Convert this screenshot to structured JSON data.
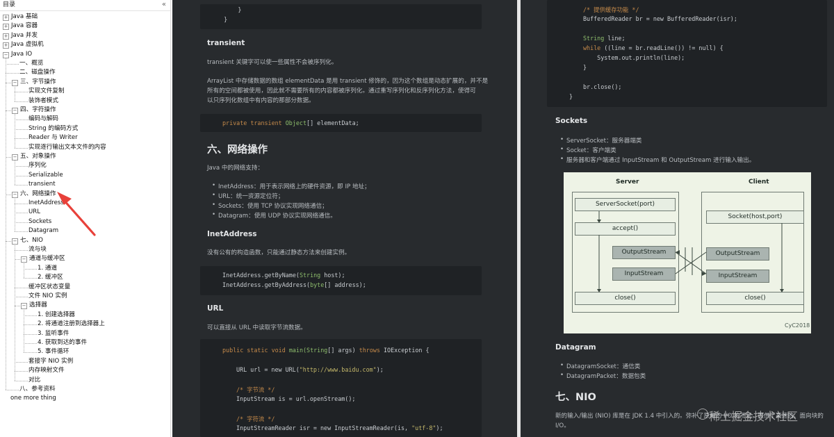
{
  "sidebar": {
    "title": "目录",
    "close": "«",
    "toc": [
      {
        "label": "Java 基础",
        "level": 0,
        "toggle": "+"
      },
      {
        "label": "Java 容器",
        "level": 0,
        "toggle": "+"
      },
      {
        "label": "Java 并发",
        "level": 0,
        "toggle": "+"
      },
      {
        "label": "Java 虚拟机",
        "level": 0,
        "toggle": "+"
      },
      {
        "label": "Java IO",
        "level": 0,
        "toggle": "−"
      },
      {
        "label": "一、概览",
        "level": 1
      },
      {
        "label": "二、磁盘操作",
        "level": 1
      },
      {
        "label": "三、字节操作",
        "level": 1,
        "toggle": "−"
      },
      {
        "label": "实现文件复制",
        "level": 2
      },
      {
        "label": "装饰者模式",
        "level": 2
      },
      {
        "label": "四、字符操作",
        "level": 1,
        "toggle": "−"
      },
      {
        "label": "编码与解码",
        "level": 2
      },
      {
        "label": "String 的编码方式",
        "level": 2
      },
      {
        "label": "Reader 与 Writer",
        "level": 2
      },
      {
        "label": "实现逐行输出文本文件的内容",
        "level": 2
      },
      {
        "label": "五、对象操作",
        "level": 1,
        "toggle": "−"
      },
      {
        "label": "序列化",
        "level": 2
      },
      {
        "label": "Serializable",
        "level": 2
      },
      {
        "label": "transient",
        "level": 2
      },
      {
        "label": "六、网络操作",
        "level": 1,
        "toggle": "−",
        "highlight": true
      },
      {
        "label": "InetAddress",
        "level": 2
      },
      {
        "label": "URL",
        "level": 2
      },
      {
        "label": "Sockets",
        "level": 2
      },
      {
        "label": "Datagram",
        "level": 2
      },
      {
        "label": "七、NIO",
        "level": 1,
        "toggle": "−"
      },
      {
        "label": "流与块",
        "level": 2
      },
      {
        "label": "通道与缓冲区",
        "level": 2,
        "toggle": "−"
      },
      {
        "label": "1. 通道",
        "level": 3
      },
      {
        "label": "2. 缓冲区",
        "level": 3
      },
      {
        "label": "缓冲区状态变量",
        "level": 2
      },
      {
        "label": "文件 NIO 实例",
        "level": 2
      },
      {
        "label": "选择器",
        "level": 2,
        "toggle": "−"
      },
      {
        "label": "1. 创建选择器",
        "level": 3
      },
      {
        "label": "2. 将通道注册到选择器上",
        "level": 3
      },
      {
        "label": "3. 监听事件",
        "level": 3
      },
      {
        "label": "4. 获取到达的事件",
        "level": 3
      },
      {
        "label": "5. 事件循环",
        "level": 3
      },
      {
        "label": "套接字 NIO 实例",
        "level": 2
      },
      {
        "label": "内存映射文件",
        "level": 2
      },
      {
        "label": "对比",
        "level": 2
      },
      {
        "label": "八、参考资料",
        "level": 1
      },
      {
        "label": "one more thing",
        "level": 0
      }
    ]
  },
  "left": {
    "code_top": [
      "        }",
      "    }"
    ],
    "h_transient": "transient",
    "p_transient": "transient 关键字可以使一些属性不会被序列化。",
    "p_arraylist": [
      "ArrayList 中存储数据的数组 elementData 是用 transient 修饰的，因为这个数组是动态扩展的，并不是",
      "所有的空间都被使用，因此就不需要所有的内容都被序列化。通过重写序列化和反序列化方法，使得可",
      "以只序列化数组中有内容的那部分数据。"
    ],
    "code_transient": {
      "kw": "private transient ",
      "ty": "Object",
      "rest": "[] elementData;"
    },
    "h_network": "六、网络操作",
    "p_network": "Java 中的网络支持：",
    "net_list": [
      "InetAddress：用于表示网络上的硬件资源，即 IP 地址；",
      "URL：统一资源定位符；",
      "Sockets：使用 TCP 协议实现网络通信；",
      "Datagram：使用 UDP 协议实现网络通信。"
    ],
    "h_inet": "InetAddress",
    "p_inet": "没有公有的构造函数，只能通过静态方法来创建实例。",
    "code_inet": [
      {
        "a": "InetAddress.getByName(",
        "t": "String",
        "b": " host);"
      },
      {
        "a": "InetAddress.getByAddress(",
        "t": "byte",
        "b": "[] address);"
      }
    ],
    "h_url": "URL",
    "p_url": "可以直接从 URL 中读取字节流数据。",
    "code_url": {
      "l1": {
        "kw": "public static void ",
        "fn": "main(",
        "ty": "String",
        "mid": "[] args) ",
        "kw2": "throws",
        "end": " IOException {"
      },
      "l2": {
        "a": "URL url = new URL(",
        "s": "\"http://www.baidu.com\"",
        "b": ");"
      },
      "c1": "/* 字节流 */",
      "l3": "InputStream is = url.openStream();",
      "c2": "/* 字符流 */",
      "l4": {
        "a": "InputStreamReader isr = new InputStreamReader(is, ",
        "s": "\"utf-8\"",
        "b": ");"
      }
    }
  },
  "right": {
    "code_top": [
      {
        "c": "/* 提供缓存功能 */"
      },
      {
        "t": "BufferedReader br = new BufferedReader(isr);"
      },
      {
        "t": ""
      },
      {
        "ty": "String",
        "t": " line;"
      },
      {
        "kw": "while",
        "t": " ((line = br.readLine()) != null) {"
      },
      {
        "t": "    System.out.println(line);"
      },
      {
        "t": "}"
      },
      {
        "t": ""
      },
      {
        "t": "br.close();"
      }
    ],
    "code_close": "}",
    "h_sockets": "Sockets",
    "sockets_list": [
      "ServerSocket：服务器端类",
      "Socket：客户端类",
      "服务器和客户端通过 InputStream 和 OutputStream 进行输入输出。"
    ],
    "diagram": {
      "server_title": "Server",
      "client_title": "Client",
      "server_socket": "ServerSocket(port)",
      "accept": "accept()",
      "output_stream_s": "OutputStream",
      "input_stream_s": "InputStream",
      "close_s": "close()",
      "socket": "Socket(host,port)",
      "output_stream_c": "OutputStream",
      "input_stream_c": "InputStream",
      "close_c": "close()",
      "credit": "CyC2018"
    },
    "h_datagram": "Datagram",
    "datagram_list": [
      "DatagramSocket：通信类",
      "DatagramPacket：数据包类"
    ],
    "h_nio": "七、NIO",
    "p_nio": [
      "新的输入/输出 (NIO) 库是在 JDK 1.4 中引入的。弥补了原来的 I/O 的不足，提供了高速的、面向块的",
      "I/O。"
    ]
  },
  "watermark": "稀土掘金技术社区",
  "colors": {
    "panel_bg": "#282b2e",
    "code_bg": "#1f2225",
    "keyword": "#c58a4a",
    "type": "#8fbf6d",
    "string": "#c4b86a",
    "arrow": "#e8413a"
  }
}
